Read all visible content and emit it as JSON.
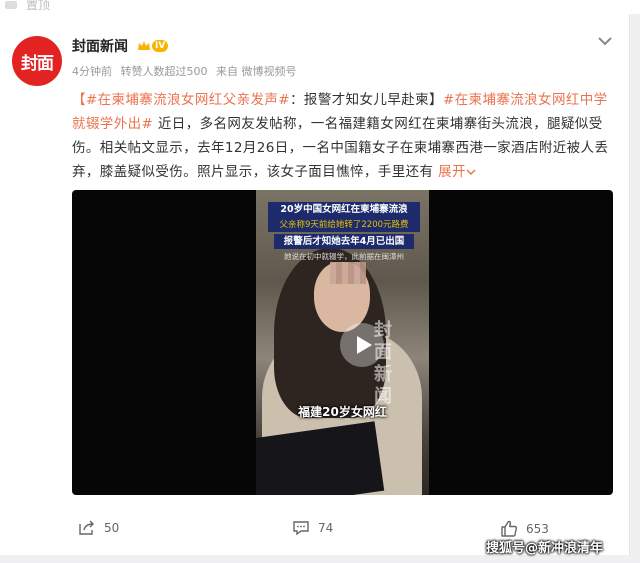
{
  "top_strip": {
    "label": "置顶"
  },
  "post": {
    "avatar_text": "封面",
    "author": "封面新闻",
    "vip_level": "IV",
    "meta": {
      "time": "4分钟前",
      "reposts": "转赞人数超过500",
      "source": "来自 微博视频号"
    },
    "body": {
      "tag1": "【#在柬埔寨流浪女网红父亲发声#",
      "text1": "：报警才知女儿早赴柬】",
      "tag2": "#在柬埔寨流浪女网红中学就辍学外出#",
      "text2": " 近日，多名网友发帖称，一名福建籍女网红在柬埔寨街头流浪，腿疑似受伤。相关帖文显示，去年12月26日，一名中国籍女子在柬埔寨西港一家酒店附近被人丢弃，膝盖疑似受伤。照片显示，该女子面目憔悴，手里还有",
      "expand": "展开"
    },
    "video": {
      "banner1": "20岁中国女网红在柬埔寨流浪",
      "banner2": "父亲称9天前给她转了2200元路费",
      "banner3": "报警后才知她去年4月已出国",
      "banner4": "她说在初中就辍学，此前据在闽漳州",
      "watermark": "封面新闻",
      "caption": "福建20岁女网红"
    },
    "actions": {
      "share": "50",
      "comment": "74",
      "like": "653"
    }
  },
  "footer_watermark": "搜狐号@新冲浪清年",
  "colors": {
    "link": "#eb7350",
    "avatar": "#e32322",
    "vip": "#f7b500",
    "video_bg": "#060606"
  }
}
